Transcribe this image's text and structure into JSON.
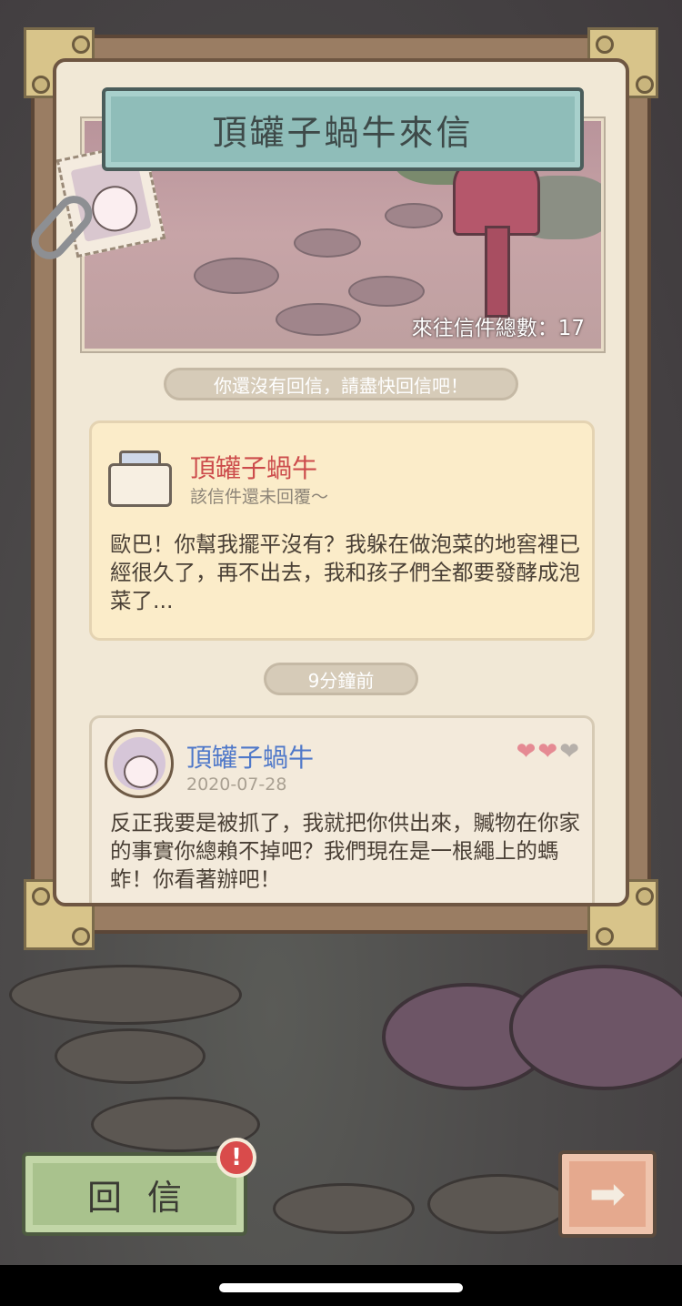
{
  "header": {
    "title": "頂罐子蝸牛來信",
    "letter_count": "來往信件總數：17"
  },
  "notice": "你還沒有回信，請盡快回信吧！",
  "letters": [
    {
      "sender": "頂罐子蝸牛",
      "status": "該信件還未回覆～",
      "body": "歐巴！你幫我擺平沒有？我躲在做泡菜的地窖裡已經很久了，再不出去，我和孩子們全都要發酵成泡菜了..."
    },
    {
      "time": "9分鐘前",
      "sender": "頂罐子蝸牛",
      "date": "2020-07-28",
      "hearts_filled": 2,
      "hearts_total": 3,
      "body": "反正我要是被抓了，我就把你供出來，贓物在你家的事實你總賴不掉吧？我們現在是一根繩上的螞蚱！你看著辦吧！"
    }
  ],
  "buttons": {
    "reply": "回信",
    "badge": "!",
    "next_icon": "right-arrow-icon"
  },
  "colors": {
    "sender_unreplied": "#cc4b4b",
    "sender_replied": "#4f78c9",
    "heart_filled": "#e58a93",
    "heart_empty": "#b6b0aa"
  }
}
